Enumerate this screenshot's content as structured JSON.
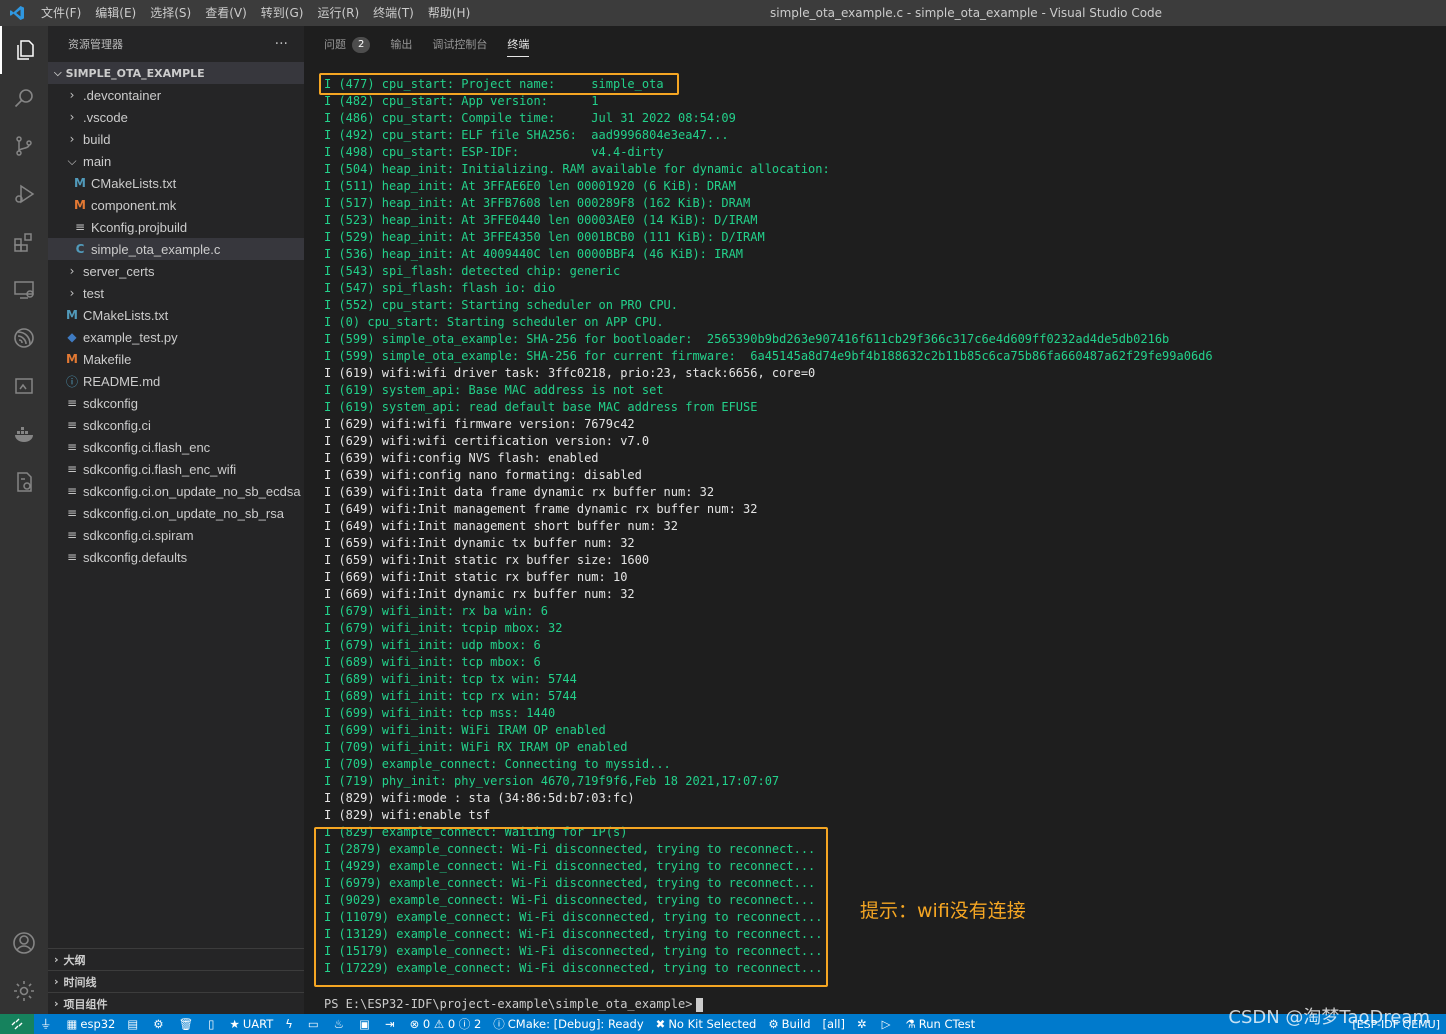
{
  "titlebar": {
    "menu": [
      "文件(F)",
      "编辑(E)",
      "选择(S)",
      "查看(V)",
      "转到(G)",
      "运行(R)",
      "终端(T)",
      "帮助(H)"
    ],
    "title": "simple_ota_example.c - simple_ota_example - Visual Studio Code"
  },
  "sidebar": {
    "title": "资源管理器",
    "more": "···",
    "root": "SIMPLE_OTA_EXAMPLE",
    "items": [
      {
        "label": ".devcontainer",
        "icon": "chevron-right"
      },
      {
        "label": ".vscode",
        "icon": "chevron-right"
      },
      {
        "label": "build",
        "icon": "chevron-right"
      },
      {
        "label": "main",
        "icon": "chevron-down"
      },
      {
        "label": "CMakeLists.txt",
        "icon": "cmake"
      },
      {
        "label": "component.mk",
        "icon": "makefile"
      },
      {
        "label": "Kconfig.projbuild",
        "icon": "lines"
      },
      {
        "label": "simple_ota_example.c",
        "icon": "c"
      },
      {
        "label": "server_certs",
        "icon": "chevron-right"
      },
      {
        "label": "test",
        "icon": "chevron-right"
      },
      {
        "label": "CMakeLists.txt",
        "icon": "cmake"
      },
      {
        "label": "example_test.py",
        "icon": "python"
      },
      {
        "label": "Makefile",
        "icon": "makefile"
      },
      {
        "label": "README.md",
        "icon": "info"
      },
      {
        "label": "sdkconfig",
        "icon": "lines"
      },
      {
        "label": "sdkconfig.ci",
        "icon": "lines"
      },
      {
        "label": "sdkconfig.ci.flash_enc",
        "icon": "lines"
      },
      {
        "label": "sdkconfig.ci.flash_enc_wifi",
        "icon": "lines"
      },
      {
        "label": "sdkconfig.ci.on_update_no_sb_ecdsa",
        "icon": "lines"
      },
      {
        "label": "sdkconfig.ci.on_update_no_sb_rsa",
        "icon": "lines"
      },
      {
        "label": "sdkconfig.ci.spiram",
        "icon": "lines"
      },
      {
        "label": "sdkconfig.defaults",
        "icon": "lines"
      }
    ],
    "sections": [
      "大纲",
      "时间线",
      "项目组件"
    ]
  },
  "panel": {
    "tabs": [
      {
        "label": "问题",
        "badge": "2"
      },
      {
        "label": "输出"
      },
      {
        "label": "调试控制台"
      },
      {
        "label": "终端"
      }
    ],
    "active_tab": "终端",
    "terminal_lines": [
      {
        "text": "I (477) cpu_start: Project name:     simple_ota",
        "color": "green"
      },
      {
        "text": "I (482) cpu_start: App version:      1",
        "color": "green"
      },
      {
        "text": "I (486) cpu_start: Compile time:     Jul 31 2022 08:54:09",
        "color": "green"
      },
      {
        "text": "I (492) cpu_start: ELF file SHA256:  aad9996804e3ea47...",
        "color": "green"
      },
      {
        "text": "I (498) cpu_start: ESP-IDF:          v4.4-dirty",
        "color": "green"
      },
      {
        "text": "I (504) heap_init: Initializing. RAM available for dynamic allocation:",
        "color": "green"
      },
      {
        "text": "I (511) heap_init: At 3FFAE6E0 len 00001920 (6 KiB): DRAM",
        "color": "green"
      },
      {
        "text": "I (517) heap_init: At 3FFB7608 len 000289F8 (162 KiB): DRAM",
        "color": "green"
      },
      {
        "text": "I (523) heap_init: At 3FFE0440 len 00003AE0 (14 KiB): D/IRAM",
        "color": "green"
      },
      {
        "text": "I (529) heap_init: At 3FFE4350 len 0001BCB0 (111 KiB): D/IRAM",
        "color": "green"
      },
      {
        "text": "I (536) heap_init: At 4009440C len 0000BBF4 (46 KiB): IRAM",
        "color": "green"
      },
      {
        "text": "I (543) spi_flash: detected chip: generic",
        "color": "green"
      },
      {
        "text": "I (547) spi_flash: flash io: dio",
        "color": "green"
      },
      {
        "text": "I (552) cpu_start: Starting scheduler on PRO CPU.",
        "color": "green"
      },
      {
        "text": "I (0) cpu_start: Starting scheduler on APP CPU.",
        "color": "green"
      },
      {
        "text": "I (599) simple_ota_example: SHA-256 for bootloader:  2565390b9bd263e907416f611cb29f366c317c6e4d609ff0232ad4de5db0216b",
        "color": "green"
      },
      {
        "text": "I (599) simple_ota_example: SHA-256 for current firmware:  6a45145a8d74e9bf4b188632c2b11b85c6ca75b86fa660487a62f29fe99a06d6",
        "color": "green"
      },
      {
        "text": "I (619) wifi:wifi driver task: 3ffc0218, prio:23, stack:6656, core=0",
        "color": "white"
      },
      {
        "text": "I (619) system_api: Base MAC address is not set",
        "color": "green"
      },
      {
        "text": "I (619) system_api: read default base MAC address from EFUSE",
        "color": "green"
      },
      {
        "text": "I (629) wifi:wifi firmware version: 7679c42",
        "color": "white"
      },
      {
        "text": "I (629) wifi:wifi certification version: v7.0",
        "color": "white"
      },
      {
        "text": "I (639) wifi:config NVS flash: enabled",
        "color": "white"
      },
      {
        "text": "I (639) wifi:config nano formating: disabled",
        "color": "white"
      },
      {
        "text": "I (639) wifi:Init data frame dynamic rx buffer num: 32",
        "color": "white"
      },
      {
        "text": "I (649) wifi:Init management frame dynamic rx buffer num: 32",
        "color": "white"
      },
      {
        "text": "I (649) wifi:Init management short buffer num: 32",
        "color": "white"
      },
      {
        "text": "I (659) wifi:Init dynamic tx buffer num: 32",
        "color": "white"
      },
      {
        "text": "I (659) wifi:Init static rx buffer size: 1600",
        "color": "white"
      },
      {
        "text": "I (669) wifi:Init static rx buffer num: 10",
        "color": "white"
      },
      {
        "text": "I (669) wifi:Init dynamic rx buffer num: 32",
        "color": "white"
      },
      {
        "text": "I (679) wifi_init: rx ba win: 6",
        "color": "green"
      },
      {
        "text": "I (679) wifi_init: tcpip mbox: 32",
        "color": "green"
      },
      {
        "text": "I (679) wifi_init: udp mbox: 6",
        "color": "green"
      },
      {
        "text": "I (689) wifi_init: tcp mbox: 6",
        "color": "green"
      },
      {
        "text": "I (689) wifi_init: tcp tx win: 5744",
        "color": "green"
      },
      {
        "text": "I (689) wifi_init: tcp rx win: 5744",
        "color": "green"
      },
      {
        "text": "I (699) wifi_init: tcp mss: 1440",
        "color": "green"
      },
      {
        "text": "I (699) wifi_init: WiFi IRAM OP enabled",
        "color": "green"
      },
      {
        "text": "I (709) wifi_init: WiFi RX IRAM OP enabled",
        "color": "green"
      },
      {
        "text": "I (709) example_connect: Connecting to myssid...",
        "color": "green"
      },
      {
        "text": "I (719) phy_init: phy_version 4670,719f9f6,Feb 18 2021,17:07:07",
        "color": "green"
      },
      {
        "text": "I (829) wifi:mode : sta (34:86:5d:b7:03:fc)",
        "color": "white"
      },
      {
        "text": "I (829) wifi:enable tsf",
        "color": "white"
      },
      {
        "text": "I (829) example_connect: Waiting for IP(s)",
        "color": "green"
      },
      {
        "text": "I (2879) example_connect: Wi-Fi disconnected, trying to reconnect...",
        "color": "green"
      },
      {
        "text": "I (4929) example_connect: Wi-Fi disconnected, trying to reconnect...",
        "color": "green"
      },
      {
        "text": "I (6979) example_connect: Wi-Fi disconnected, trying to reconnect...",
        "color": "green"
      },
      {
        "text": "I (9029) example_connect: Wi-Fi disconnected, trying to reconnect...",
        "color": "green"
      },
      {
        "text": "I (11079) example_connect: Wi-Fi disconnected, trying to reconnect...",
        "color": "green"
      },
      {
        "text": "I (13129) example_connect: Wi-Fi disconnected, trying to reconnect...",
        "color": "green"
      },
      {
        "text": "I (15179) example_connect: Wi-Fi disconnected, trying to reconnect...",
        "color": "green"
      },
      {
        "text": "I (17229) example_connect: Wi-Fi disconnected, trying to reconnect...",
        "color": "green"
      }
    ],
    "prompt": "PS E:\\ESP32-IDF\\project-example\\simple_ota_example>",
    "annotation": "提示：wifi没有连接"
  },
  "statusbar": {
    "items": [
      {
        "icon": "plug-icon",
        "label": ""
      },
      {
        "icon": "chip-icon",
        "label": "esp32"
      },
      {
        "icon": "folder-icon",
        "label": ""
      },
      {
        "icon": "gear-icon",
        "label": ""
      },
      {
        "icon": "trash-icon",
        "label": ""
      },
      {
        "icon": "cylinder-icon",
        "label": ""
      },
      {
        "icon": "star-icon",
        "label": "UART"
      },
      {
        "icon": "flash-icon",
        "label": ""
      },
      {
        "icon": "monitor-icon",
        "label": ""
      },
      {
        "icon": "flame-icon",
        "label": ""
      },
      {
        "icon": "terminal-icon",
        "label": ""
      },
      {
        "icon": "enter-icon",
        "label": ""
      },
      {
        "icon": "problems-icon",
        "label": "⊗ 0 ⚠ 0 ⓘ 2"
      },
      {
        "icon": "info-icon",
        "label": "CMake: [Debug]: Ready"
      },
      {
        "icon": "tools-icon",
        "label": "No Kit Selected"
      },
      {
        "icon": "build-icon",
        "label": "Build"
      },
      {
        "icon": "",
        "label": "[all]"
      },
      {
        "icon": "bug-icon",
        "label": ""
      },
      {
        "icon": "play-icon",
        "label": ""
      },
      {
        "icon": "flask-icon",
        "label": "Run CTest"
      }
    ],
    "right": "[ESP-IDF QEMU]"
  },
  "watermark": "CSDN @淘梦TaoDream",
  "colors": {
    "accent": "#007acc",
    "terminal_green": "#23d18b",
    "highlight": "#f5a623"
  }
}
